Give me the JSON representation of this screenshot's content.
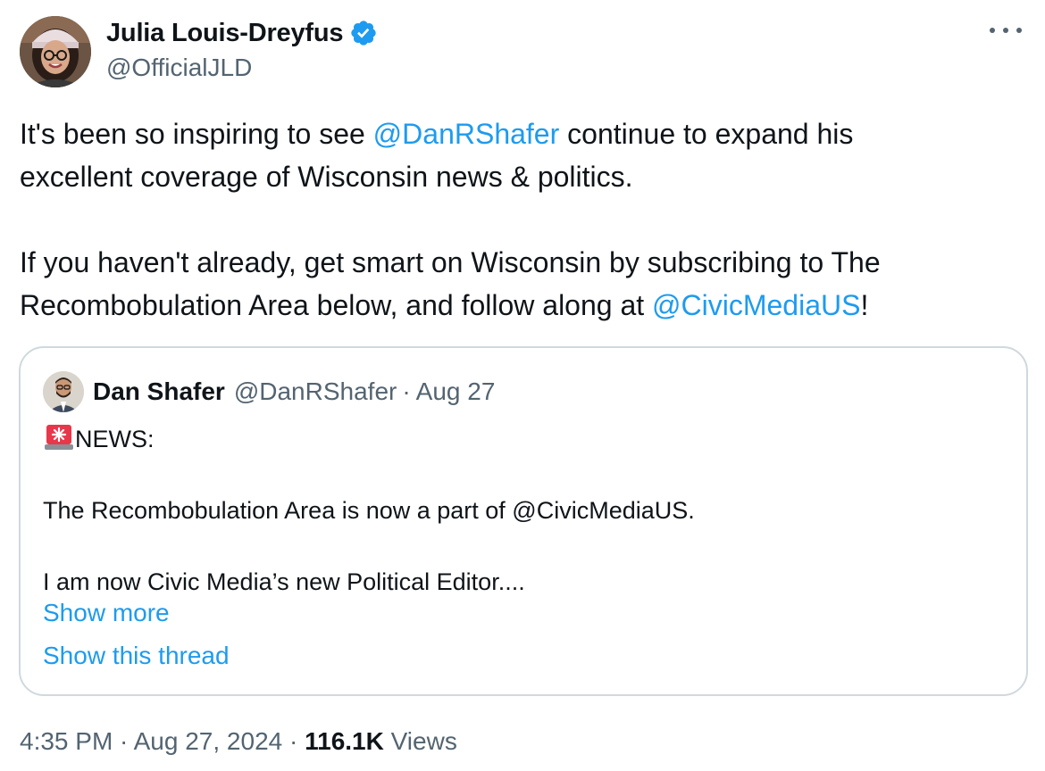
{
  "author": {
    "display_name": "Julia Louis-Dreyfus",
    "handle": "@OfficialJLD",
    "verified": true
  },
  "tweet": {
    "p1_before": "It's been so inspiring to see ",
    "p1_mention": "@DanRShafer",
    "p1_after_line1": " continue to expand his",
    "p1_line2": "excellent coverage of Wisconsin news & politics.",
    "p2_line1": "If you haven't already, get smart on Wisconsin by subscribing to The",
    "p2_line2_before": "Recombobulation Area below, and follow along at ",
    "p2_mention": "@CivicMediaUS",
    "p2_after": "!"
  },
  "quote": {
    "name": "Dan Shafer",
    "handle": "@DanRShafer",
    "separator": "·",
    "date": "Aug 27",
    "news_label": "NEWS:",
    "line2": "The Recombobulation Area is now a part of @CivicMediaUS.",
    "line3": "I am now Civic Media’s new Political Editor....",
    "show_more": "Show more",
    "show_thread": "Show this thread"
  },
  "meta": {
    "time": "4:35 PM",
    "sep1": " · ",
    "date": "Aug 27, 2024",
    "sep2": " · ",
    "views_count": "116.1K",
    "views_label": " Views"
  },
  "icons": {
    "verified": "verified-badge-icon",
    "more": "more-icon",
    "siren": "siren-icon"
  },
  "colors": {
    "accent": "#1d9bf0",
    "text": "#0f1419",
    "secondary": "#536471",
    "border": "#cfd9de"
  }
}
